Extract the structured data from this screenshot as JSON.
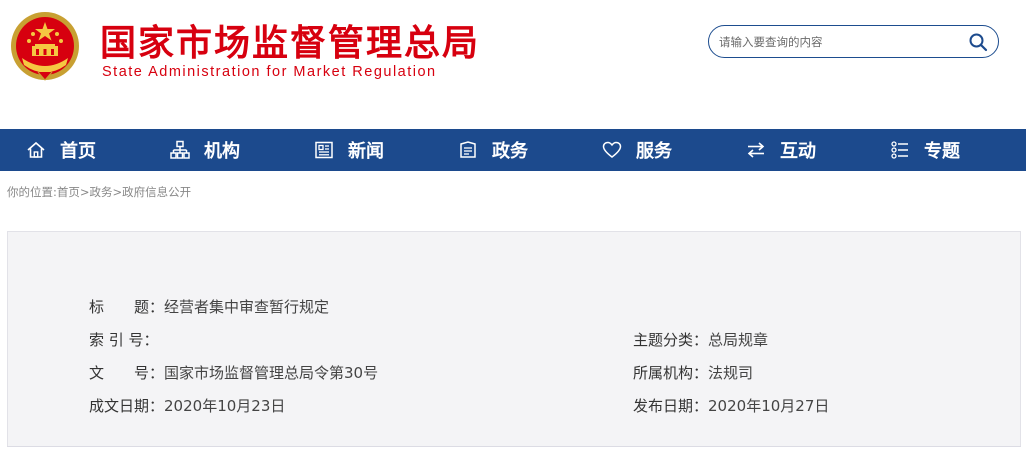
{
  "header": {
    "title_cn": "国家市场监督管理总局",
    "title_en": "State Administration for Market Regulation",
    "emblem_icon": "national-emblem-icon"
  },
  "search": {
    "placeholder": "请输入要查询的内容",
    "icon": "search-icon"
  },
  "nav": {
    "items": [
      {
        "label": "首页",
        "icon": "home-icon"
      },
      {
        "label": "机构",
        "icon": "org-chart-icon"
      },
      {
        "label": "新闻",
        "icon": "newspaper-icon"
      },
      {
        "label": "政务",
        "icon": "document-icon"
      },
      {
        "label": "服务",
        "icon": "heart-icon"
      },
      {
        "label": "互动",
        "icon": "exchange-arrows-icon"
      },
      {
        "label": "专题",
        "icon": "list-icon"
      }
    ],
    "bg_color": "#1c4a8d"
  },
  "breadcrumb": {
    "prefix": "你的位置:",
    "items": [
      "首页",
      "政务",
      "政府信息公开"
    ],
    "separator": ">"
  },
  "info": {
    "title_key": "标　　题：",
    "title_val": "经营者集中审查暂行规定",
    "index_key": "索 引 号：",
    "index_val": "",
    "topic_key": "主题分类：",
    "topic_val": "总局规章",
    "docno_key": "文　　号：",
    "docno_val": "国家市场监督管理总局令第30号",
    "org_key": "所属机构：",
    "org_val": "法规司",
    "created_key": "成文日期：",
    "created_val": "2020年10月23日",
    "published_key": "发布日期：",
    "published_val": "2020年10月27日"
  },
  "colors": {
    "brand_red": "#d7000f",
    "brand_blue": "#1c4a8d"
  }
}
